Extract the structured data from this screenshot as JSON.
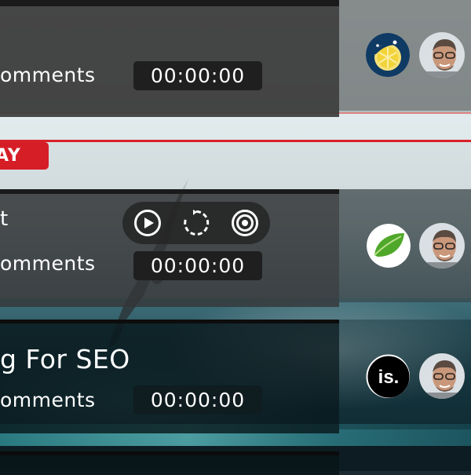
{
  "cards": [
    {
      "comments": "omments",
      "timer": "00:00:00"
    },
    {
      "title_partial": "t",
      "comments": "omments",
      "timer": "00:00:00"
    },
    {
      "title": "g For SEO",
      "comments": "omments",
      "timer": "00:00:00"
    }
  ],
  "banner": {
    "tag": "AY"
  },
  "controls": {
    "icons": [
      "play-icon",
      "refresh-icon",
      "target-icon"
    ]
  },
  "logos": {
    "card1": {
      "icon": "lemon-logo",
      "bg": "#0f3a64",
      "fruit": "#f2d43a"
    },
    "card2": {
      "icon": "leaf-logo",
      "bg": "#ffffff",
      "leaf": "#4fa82a"
    },
    "card3": {
      "icon": "is-logo",
      "text": "is.",
      "bg": "#000000"
    }
  },
  "colors": {
    "accent_red": "#d61e27"
  }
}
